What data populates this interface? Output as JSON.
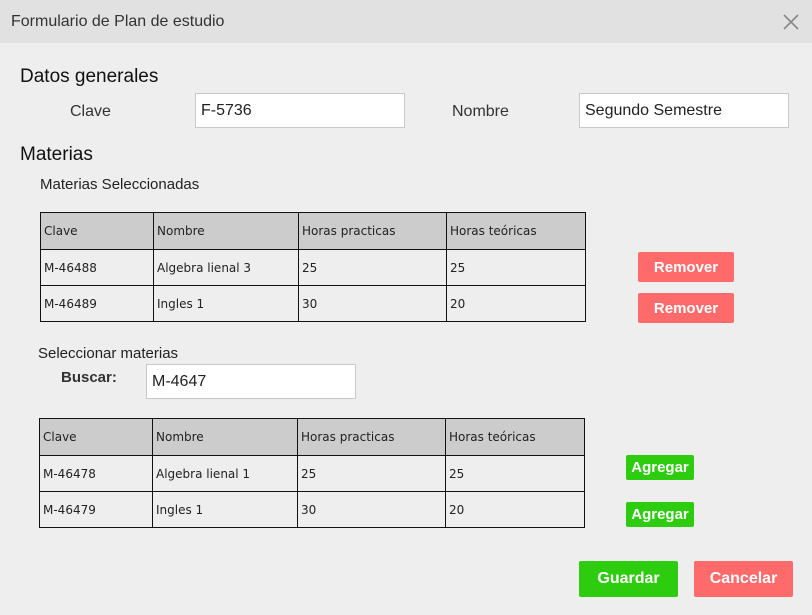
{
  "window": {
    "title": "Formulario de Plan de estudio",
    "close_icon": "close-icon"
  },
  "general": {
    "heading": "Datos generales",
    "clave_label": "Clave",
    "clave_value": "F-5736",
    "nombre_label": "Nombre",
    "nombre_value": "Segundo Semestre"
  },
  "materias": {
    "heading": "Materias",
    "selected_heading": "Materias Seleccionadas",
    "columns": [
      "Clave",
      "Nombre",
      "Horas practicas",
      "Horas teóricas"
    ],
    "selected_rows": [
      {
        "clave": "M-46488",
        "nombre": "Algebra lienal 3",
        "practicas": "25",
        "teoricas": "25"
      },
      {
        "clave": "M-46489",
        "nombre": "Ingles 1",
        "practicas": "30",
        "teoricas": "20"
      }
    ],
    "remove_label": "Remover",
    "select_heading": "Seleccionar materias",
    "search_label": "Buscar:",
    "search_value": "M-4647",
    "available_rows": [
      {
        "clave": "M-46478",
        "nombre": "Algebra lienal 1",
        "practicas": "25",
        "teoricas": "25"
      },
      {
        "clave": "M-46479",
        "nombre": "Ingles 1",
        "practicas": "30",
        "teoricas": "20"
      }
    ],
    "add_label": "Agregar"
  },
  "footer": {
    "save_label": "Guardar",
    "cancel_label": "Cancelar"
  },
  "colors": {
    "remove": "#ff6b6b",
    "add": "#2ecc0f",
    "header_bg": "#cccccc"
  }
}
